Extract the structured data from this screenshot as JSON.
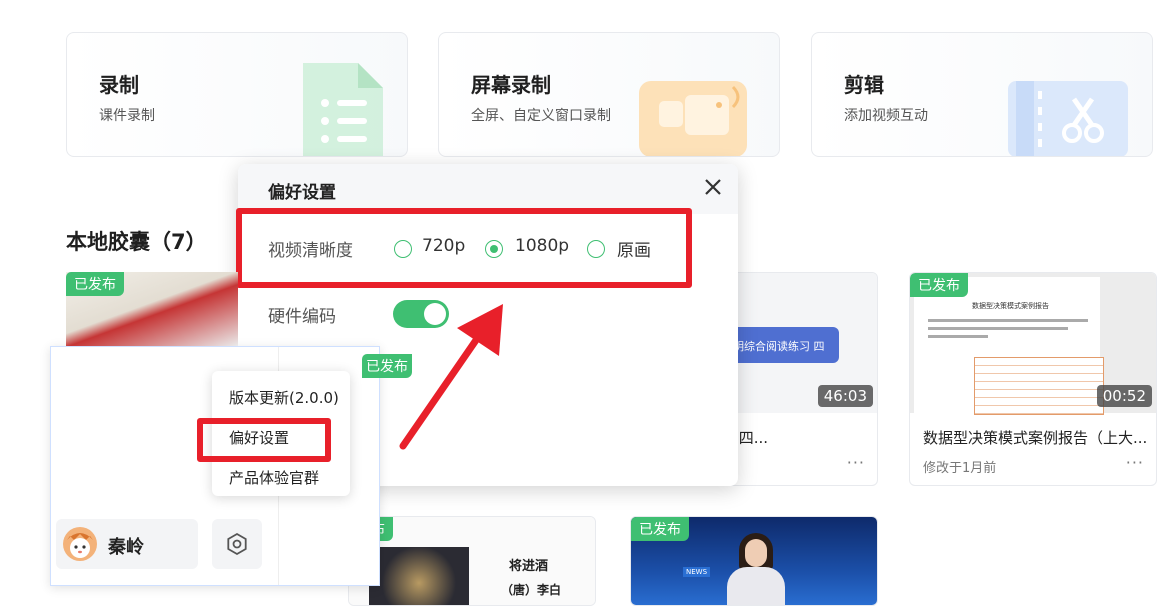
{
  "feature_cards": [
    {
      "title": "录制",
      "subtitle": "课件录制",
      "icon": "document-list-icon"
    },
    {
      "title": "屏幕录制",
      "subtitle": "全屏、自定义窗口录制",
      "icon": "screen-record-icon"
    },
    {
      "title": "剪辑",
      "subtitle": "添加视频互动",
      "icon": "scissors-film-icon"
    }
  ],
  "local_capsules": {
    "title": "本地胶囊（7）"
  },
  "badge_label": "已发布",
  "badge_label_partial": "发布",
  "videos": [
    {
      "title": "",
      "duration": "",
      "date": ""
    },
    {
      "title": "综合阅读练习 四...",
      "thumb_text": "明综合阅读练习 四",
      "duration": "46:03",
      "date": ""
    },
    {
      "title": "数据型决策模式案例报告（上大...",
      "thumb_text": "数据型决策模式案例报告",
      "duration": "00:52",
      "date": "修改于1月前"
    }
  ],
  "bottom_thumbs": {
    "poem_title": "将进酒",
    "poem_author": "（唐）李白",
    "news_label": "NEWS"
  },
  "more_label": "···",
  "preference_dialog": {
    "title": "偏好设置",
    "video_quality_label": "视频清晰度",
    "quality_options": [
      {
        "label": "720p",
        "selected": false
      },
      {
        "label": "1080p",
        "selected": true
      },
      {
        "label": "原画",
        "selected": false
      }
    ],
    "hardware_encoding_label": "硬件编码",
    "hardware_encoding_on": true
  },
  "menu": {
    "items": [
      "版本更新(2.0.0)",
      "偏好设置",
      "产品体验官群"
    ]
  },
  "user": {
    "name": "秦岭"
  },
  "colors": {
    "accent": "#3fbf72",
    "highlight": "#e8202a"
  }
}
